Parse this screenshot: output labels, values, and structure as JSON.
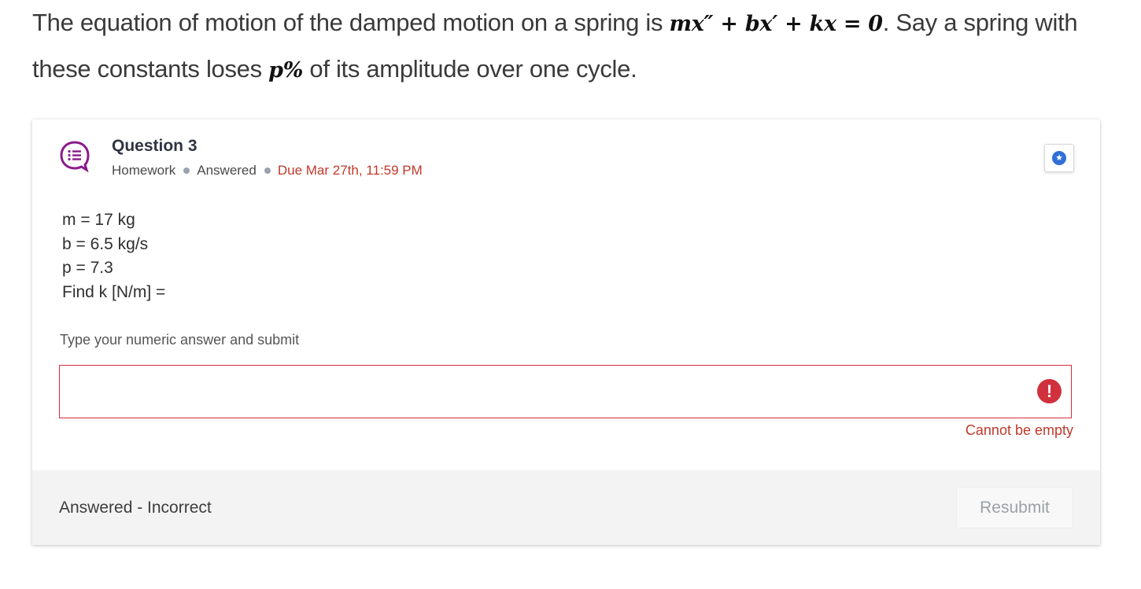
{
  "intro": {
    "line1_before": "The equation of motion of the damped motion on a spring is ",
    "equation": "mx″ + bx′ + kx = 0",
    "line1_after": ". Say a spring with",
    "line2_before": "these constants loses ",
    "percent_symbol": "p%",
    "line2_after": " of its amplitude over one cycle."
  },
  "question": {
    "title": "Question 3",
    "type": "Homework",
    "status": "Answered",
    "due": "Due Mar 27th, 11:59 PM",
    "icon": "question-list-icon",
    "star_icon": "star-icon",
    "givens": [
      "m = 17 kg",
      "b = 6.5 kg/s",
      "p = 7.3",
      "Find k [N/m] ="
    ]
  },
  "answer": {
    "prompt": "Type your numeric answer and submit",
    "value": "",
    "error_icon": "exclamation-icon",
    "error_text": "Cannot be empty"
  },
  "footer": {
    "status": "Answered - Incorrect",
    "resubmit_label": "Resubmit"
  },
  "colors": {
    "accent_purple": "#8b1a8b",
    "error_red": "#d0313d",
    "star_blue": "#2f6fd6"
  }
}
